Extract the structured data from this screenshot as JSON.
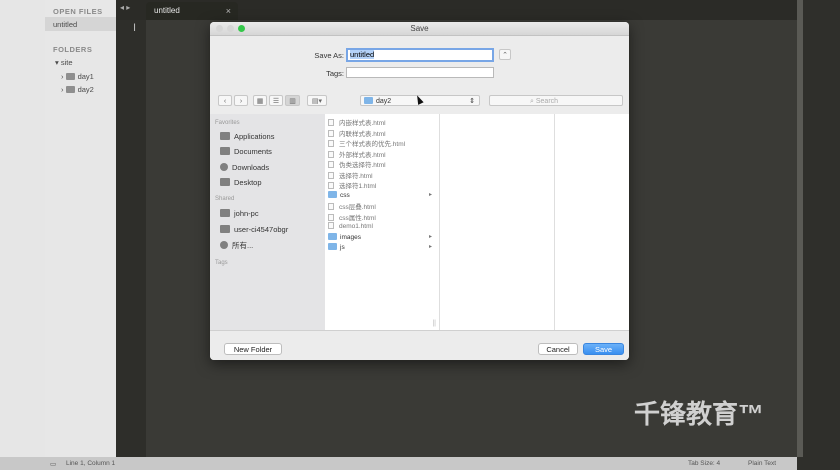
{
  "editor": {
    "tab_title": "untitled",
    "tab_close": "×",
    "nav_arrows": "◂ ▸",
    "cursor_glyph": "I"
  },
  "sidebar": {
    "open_files_label": "OPEN FILES",
    "open_file": "untitled",
    "folders_label": "FOLDERS",
    "tree": [
      {
        "label": "site"
      },
      {
        "label": "day1"
      },
      {
        "label": "day2"
      }
    ]
  },
  "statusbar": {
    "position": "Line 1, Column 1",
    "tab_size": "Tab Size: 4",
    "syntax": "Plain Text"
  },
  "dialog": {
    "title": "Save",
    "save_as_label": "Save As:",
    "save_as_value": "untitled",
    "tags_label": "Tags:",
    "tags_value": "",
    "location": "day2",
    "search_placeholder": "Search",
    "favorites_header": "Favorites",
    "favorites": [
      {
        "label": "Applications",
        "icon": "applications-icon"
      },
      {
        "label": "Documents",
        "icon": "documents-icon"
      },
      {
        "label": "Downloads",
        "icon": "downloads-icon"
      },
      {
        "label": "Desktop",
        "icon": "desktop-icon"
      }
    ],
    "shared_header": "Shared",
    "shared": [
      {
        "label": "john-pc",
        "icon": "computer-icon"
      },
      {
        "label": "user-ci4547obgr",
        "icon": "computer-icon"
      },
      {
        "label": "所有...",
        "icon": "network-icon"
      }
    ],
    "tags_header": "Tags",
    "files": [
      {
        "name": "内嵌样式表.html",
        "dir": false
      },
      {
        "name": "内联样式表.html",
        "dir": false
      },
      {
        "name": "三个样式表的优先.html",
        "dir": false
      },
      {
        "name": "外部样式表.html",
        "dir": false
      },
      {
        "name": "伪类选择符.html",
        "dir": false
      },
      {
        "name": "选择符.html",
        "dir": false
      },
      {
        "name": "选择符1.html",
        "dir": false
      },
      {
        "name": "css",
        "dir": true
      },
      {
        "name": "css层叠.html",
        "dir": false
      },
      {
        "name": "css属性.html",
        "dir": false
      },
      {
        "name": "demo1.html",
        "dir": false
      },
      {
        "name": "images",
        "dir": true
      },
      {
        "name": "js",
        "dir": true
      }
    ],
    "new_folder_label": "New Folder",
    "cancel_label": "Cancel",
    "save_label": "Save"
  },
  "watermark": "千锋教育™"
}
